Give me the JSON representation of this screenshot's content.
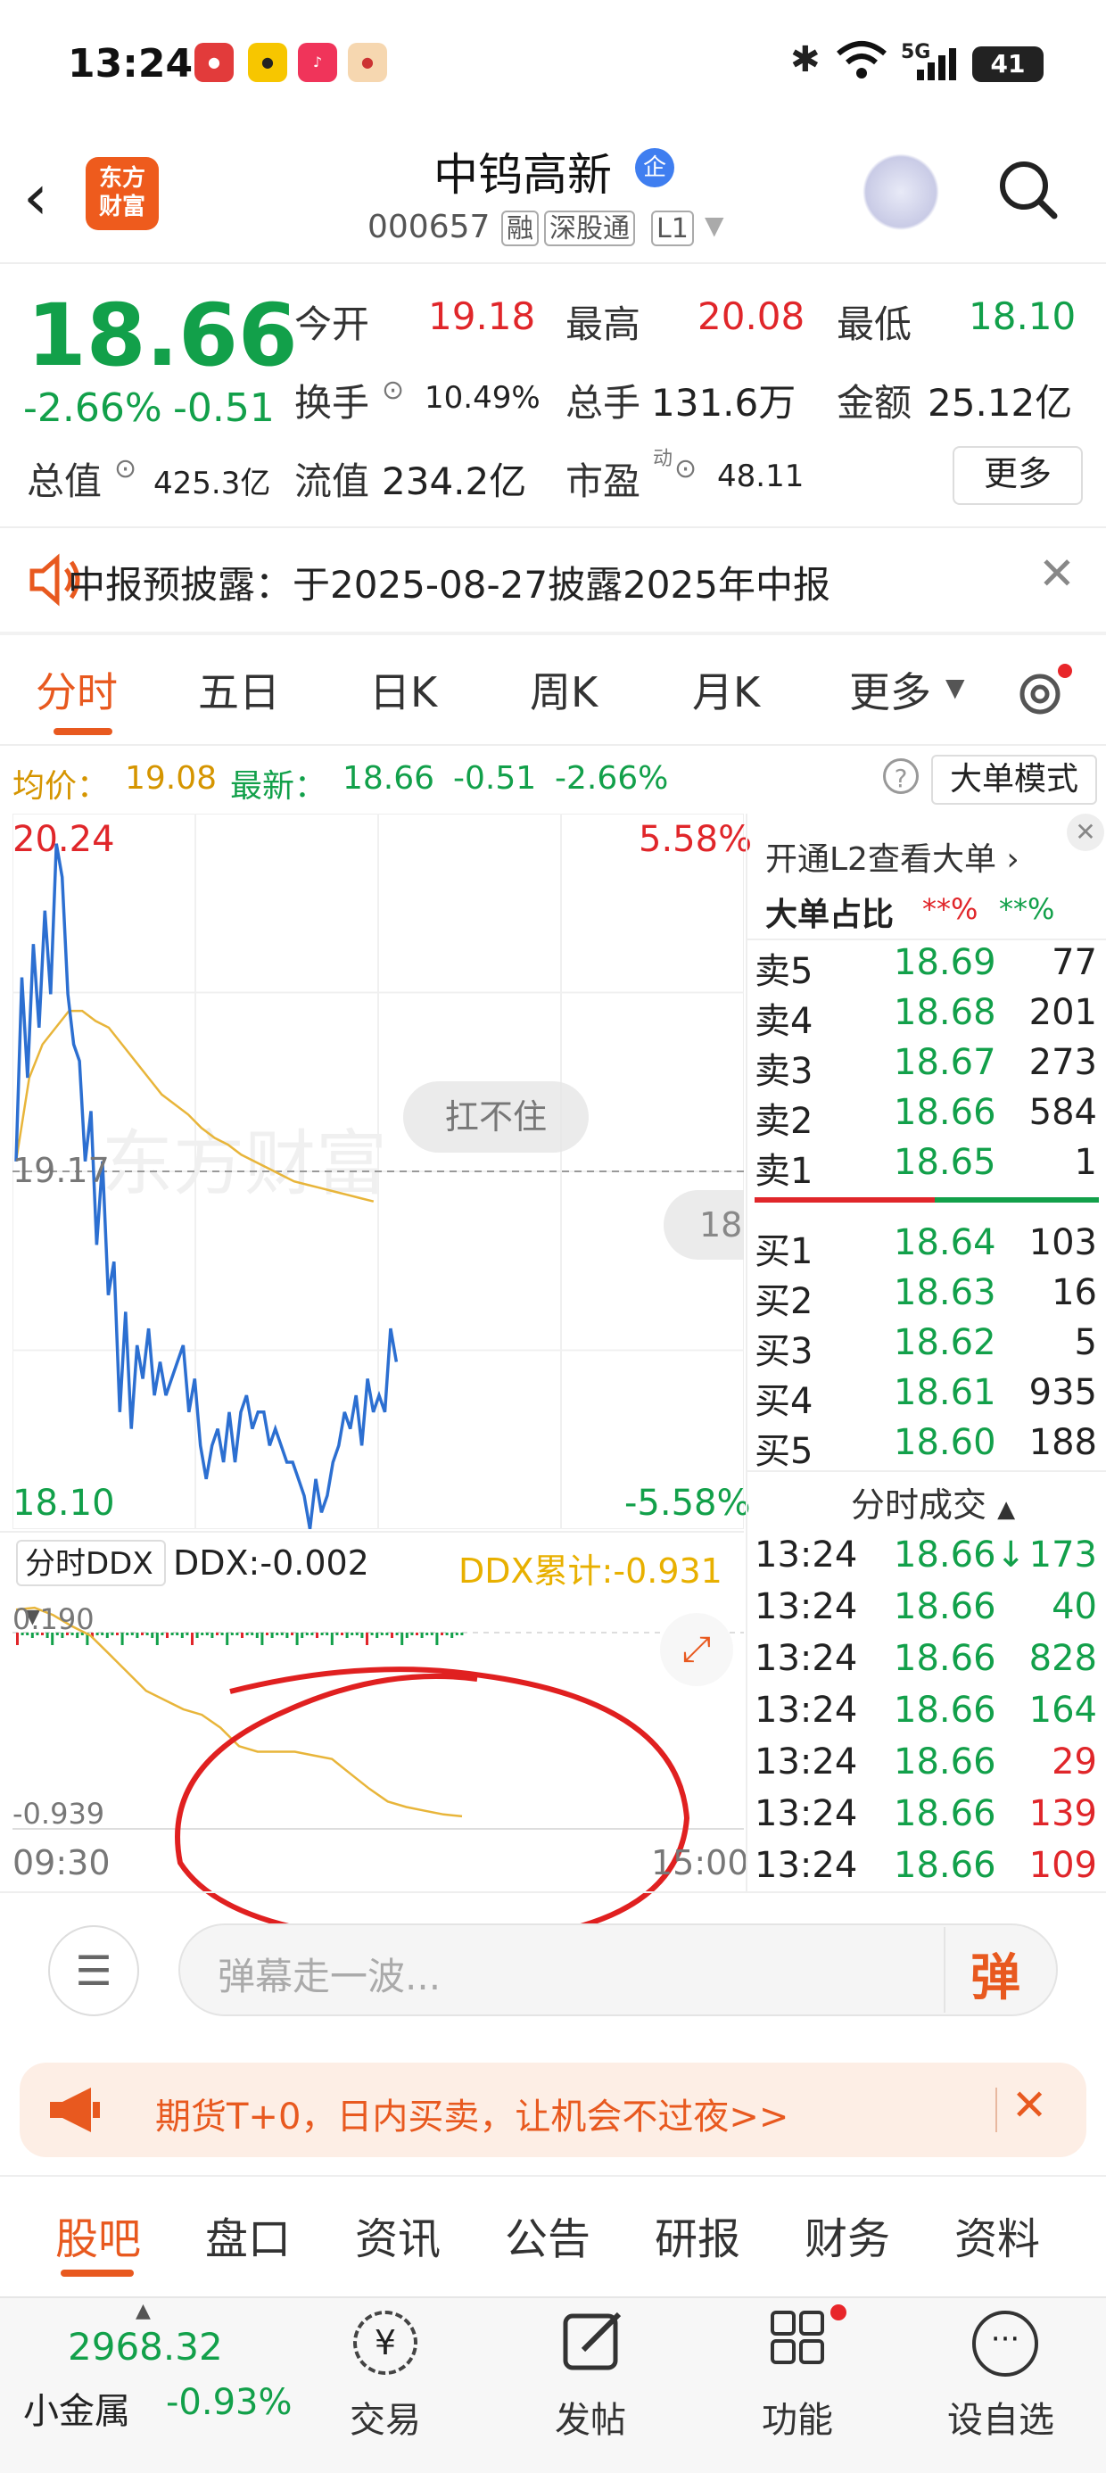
{
  "status_bar": {
    "time": "13:24",
    "network": "5G",
    "battery": "41"
  },
  "header": {
    "stock_name": "中钨高新",
    "badge": "企",
    "code": "000657",
    "tags": [
      "融",
      "深股通",
      "L1"
    ],
    "logo_text": [
      "东方",
      "财富"
    ]
  },
  "quote": {
    "price": "18.66",
    "change_pct": "-2.66%",
    "change": "-0.51",
    "open_label": "今开",
    "open": "19.18",
    "high_label": "最高",
    "high": "20.08",
    "low_label": "最低",
    "low": "18.10",
    "turnover_label": "换手",
    "turnover": "10.49%",
    "volume_label": "总手",
    "volume": "131.6万",
    "amount_label": "金额",
    "amount": "25.12亿",
    "mktcap_label": "总值",
    "mktcap": "425.3亿",
    "float_label": "流值",
    "float_cap": "234.2亿",
    "pe_label": "市盈",
    "pe_sup": "动",
    "pe": "48.11",
    "more_label": "更多"
  },
  "notice": {
    "text": "中报预披露：于2025-08-27披露2025年中报"
  },
  "chart_tabs": [
    "分时",
    "五日",
    "日K",
    "周K",
    "月K",
    "更多"
  ],
  "info_row": {
    "avg_label": "均价：",
    "avg": "19.08",
    "latest_label": "最新：",
    "latest": "18.66",
    "chg": "-0.51",
    "chg_pct": "-2.66%",
    "mode_label": "大单模式"
  },
  "chart_data": {
    "type": "line",
    "x_range": [
      "09:30",
      "15:00"
    ],
    "ylim": [
      18.1,
      20.24
    ],
    "y_top_label": "20.24",
    "y_bottom_label": "18.10",
    "pct_top_label": "5.58%",
    "pct_bottom_label": "-5.58%",
    "pre_close_label": "19.17",
    "series": [
      {
        "name": "price",
        "color": "#2c6fd1",
        "values": [
          19.2,
          19.75,
          19.45,
          19.85,
          19.6,
          19.95,
          19.7,
          20.15,
          20.05,
          19.7,
          19.55,
          19.5,
          19.2,
          19.35,
          18.95,
          19.2,
          18.8,
          18.9,
          18.45,
          18.75,
          18.4,
          18.65,
          18.55,
          18.7,
          18.5,
          18.6,
          18.5,
          18.55,
          18.6,
          18.65,
          18.45,
          18.55,
          18.35,
          18.25,
          18.35,
          18.4,
          18.3,
          18.45,
          18.3,
          18.45,
          18.5,
          18.4,
          18.45,
          18.45,
          18.35,
          18.4,
          18.35,
          18.3,
          18.3,
          18.25,
          18.2,
          18.1,
          18.25,
          18.15,
          18.2,
          18.3,
          18.35,
          18.45,
          18.4,
          18.5,
          18.35,
          18.55,
          18.45,
          18.5,
          18.45,
          18.7,
          18.6
        ]
      },
      {
        "name": "avg",
        "color": "#e8b53a",
        "values": [
          19.2,
          19.45,
          19.55,
          19.6,
          19.65,
          19.65,
          19.62,
          19.6,
          19.55,
          19.5,
          19.45,
          19.4,
          19.37,
          19.34,
          19.3,
          19.27,
          19.25,
          19.22,
          19.2,
          19.18,
          19.16,
          19.14,
          19.13,
          19.12,
          19.11,
          19.1,
          19.09,
          19.08
        ]
      }
    ],
    "watermark": "东方财富",
    "bubble": "扛不住"
  },
  "ddx": {
    "selector": "分时DDX",
    "ddx_label": "DDX:-0.002",
    "ddx_sum_label": "DDX累计:-0.931",
    "y_top": "0.190",
    "y_bottom": "-0.939",
    "x_start": "09:30",
    "x_end": "15:00"
  },
  "order_book": {
    "promo": "开通L2查看大单",
    "ratio_label": "大单占比",
    "ratio_sell": "**%",
    "ratio_buy": "**%",
    "sells": [
      {
        "label": "卖5",
        "price": "18.69",
        "vol": "77"
      },
      {
        "label": "卖4",
        "price": "18.68",
        "vol": "201"
      },
      {
        "label": "卖3",
        "price": "18.67",
        "vol": "273"
      },
      {
        "label": "卖2",
        "price": "18.66",
        "vol": "584"
      },
      {
        "label": "卖1",
        "price": "18.65",
        "vol": "1"
      }
    ],
    "buys": [
      {
        "label": "买1",
        "price": "18.64",
        "vol": "103"
      },
      {
        "label": "买2",
        "price": "18.63",
        "vol": "16"
      },
      {
        "label": "买3",
        "price": "18.62",
        "vol": "5"
      },
      {
        "label": "买4",
        "price": "18.61",
        "vol": "935"
      },
      {
        "label": "买5",
        "price": "18.60",
        "vol": "188"
      }
    ],
    "trades_label": "分时成交",
    "trades": [
      {
        "time": "13:24",
        "price": "18.66↓",
        "vol": "173",
        "side": "buy"
      },
      {
        "time": "13:24",
        "price": "18.66",
        "vol": "40",
        "side": "buy"
      },
      {
        "time": "13:24",
        "price": "18.66",
        "vol": "828",
        "side": "buy"
      },
      {
        "time": "13:24",
        "price": "18.66",
        "vol": "164",
        "side": "buy"
      },
      {
        "time": "13:24",
        "price": "18.66",
        "vol": "29",
        "side": "sell"
      },
      {
        "time": "13:24",
        "price": "18.66",
        "vol": "139",
        "side": "sell"
      },
      {
        "time": "13:24",
        "price": "18.66",
        "vol": "109",
        "side": "sell"
      }
    ],
    "side_bubble": "18"
  },
  "comment": {
    "placeholder": "弹幕走一波...",
    "send_label": "弹"
  },
  "ad": {
    "text": "期货T+0，日内买卖，让机会不过夜>>"
  },
  "bottom_tabs": [
    "股吧",
    "盘口",
    "资讯",
    "公告",
    "研报",
    "财务",
    "资料"
  ],
  "bottom_nav": {
    "index_value": "2968.32",
    "index_name": "小金属",
    "index_chg": "-0.93%",
    "items": [
      "交易",
      "发帖",
      "功能",
      "设自选"
    ]
  }
}
